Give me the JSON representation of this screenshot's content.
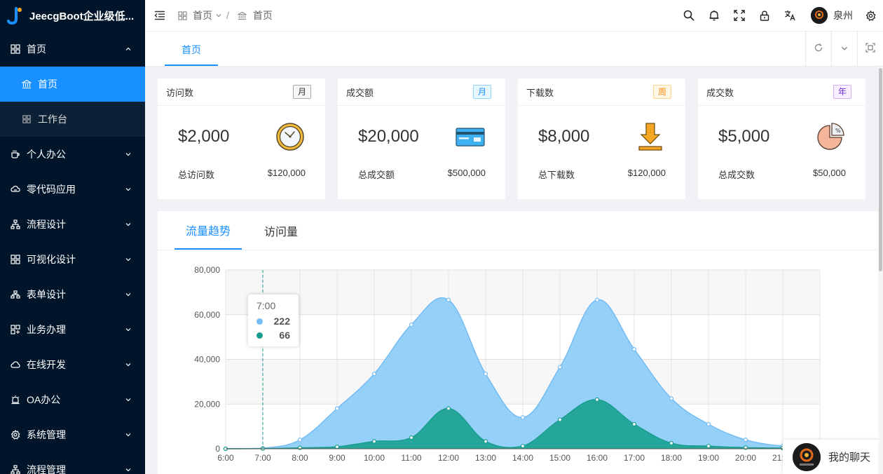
{
  "app": {
    "title": "JeecgBoot企业级低..."
  },
  "sidebar": {
    "items": [
      {
        "label": "首页",
        "icon": "dashboard-icon",
        "expanded": true
      },
      {
        "label": "个人办公",
        "icon": "coffee-icon"
      },
      {
        "label": "零代码应用",
        "icon": "cloud-app-icon"
      },
      {
        "label": "流程设计",
        "icon": "flow-icon"
      },
      {
        "label": "可视化设计",
        "icon": "grid-icon"
      },
      {
        "label": "表单设计",
        "icon": "form-icon"
      },
      {
        "label": "业务办理",
        "icon": "business-icon"
      },
      {
        "label": "在线开发",
        "icon": "cloud-icon"
      },
      {
        "label": "OA办公",
        "icon": "alarm-icon"
      },
      {
        "label": "系统管理",
        "icon": "gear-icon"
      },
      {
        "label": "流程管理",
        "icon": "process-icon"
      }
    ],
    "sub_items": [
      {
        "label": "首页",
        "active": true
      },
      {
        "label": "工作台",
        "active": false
      }
    ]
  },
  "header": {
    "breadcrumb": [
      {
        "label": "首页"
      },
      {
        "label": "首页"
      }
    ],
    "separator": "/",
    "user_name": "泉州"
  },
  "tabs": {
    "active_label": "首页"
  },
  "cards": [
    {
      "title": "访问数",
      "tag": "月",
      "tag_color": "green",
      "value": "$2,000",
      "footer_label": "总访问数",
      "footer_value": "$120,000",
      "icon": "clock-icon"
    },
    {
      "title": "成交额",
      "tag": "月",
      "tag_color": "blue",
      "value": "$20,000",
      "footer_label": "总成交额",
      "footer_value": "$500,000",
      "icon": "credit-card-icon"
    },
    {
      "title": "下载数",
      "tag": "周",
      "tag_color": "orange",
      "value": "$8,000",
      "footer_label": "总下载数",
      "footer_value": "$120,000",
      "icon": "download-icon"
    },
    {
      "title": "成交数",
      "tag": "年",
      "tag_color": "purple",
      "value": "$5,000",
      "footer_label": "总成交数",
      "footer_value": "$50,000",
      "icon": "pie-percent-icon"
    }
  ],
  "chart_tabs": [
    {
      "label": "流量趋势",
      "active": true
    },
    {
      "label": "访问量",
      "active": false
    }
  ],
  "chart_data": {
    "type": "area",
    "categories": [
      "6:00",
      "7:00",
      "8:00",
      "9:00",
      "10:00",
      "11:00",
      "12:00",
      "13:00",
      "14:00",
      "15:00",
      "16:00",
      "17:00",
      "18:00",
      "19:00",
      "20:00",
      "21:00",
      "22:00"
    ],
    "series": [
      {
        "color": "#74bcf5",
        "values": [
          0,
          222,
          4000,
          18000,
          33500,
          55500,
          66600,
          33500,
          14000,
          36500,
          66600,
          44500,
          22500,
          11000,
          4000,
          1200,
          300
        ]
      },
      {
        "color": "#1a9d8f",
        "values": [
          0,
          66,
          400,
          900,
          3300,
          5000,
          18000,
          3300,
          1200,
          13000,
          22000,
          11000,
          2500,
          1200,
          500,
          300,
          100
        ]
      }
    ],
    "y_ticks": [
      "80,000",
      "60,000",
      "40,000",
      "20,000",
      "0"
    ],
    "ylim": [
      0,
      80000
    ],
    "grid": true,
    "tooltip": {
      "title": "7:00",
      "values": [
        "222",
        "66"
      ]
    }
  },
  "chat": {
    "label": "我的聊天"
  }
}
